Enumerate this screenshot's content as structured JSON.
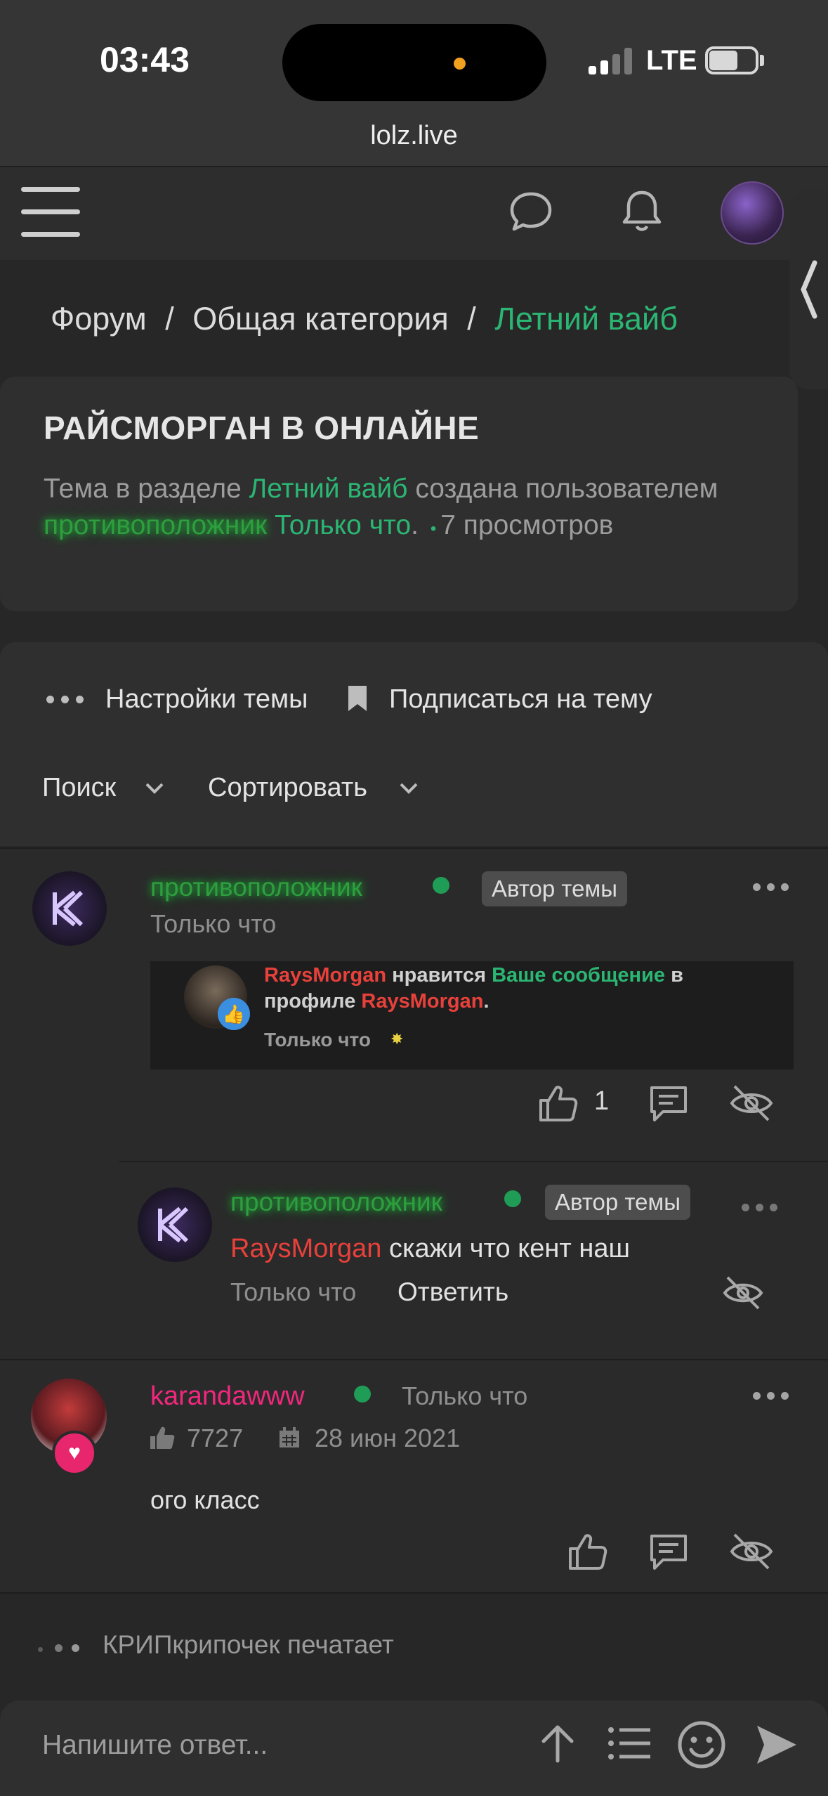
{
  "status_bar": {
    "time": "03:43",
    "network": "LTE"
  },
  "browser": {
    "url": "lolz.live"
  },
  "breadcrumb": {
    "forum": "Форум",
    "sep1": "/",
    "category": "Общая категория",
    "sep2": "/",
    "section": "Летний вайб"
  },
  "thread": {
    "title": "РАЙСМОРГАН В ОНЛАЙНЕ",
    "meta_prefix": "Тема в разделе",
    "meta_section": "Летний вайб",
    "meta_created": "создана пользователем",
    "meta_author": "противоположник",
    "meta_time": "Только что",
    "meta_dot": ".",
    "meta_bullet": "•",
    "meta_views": "7 просмотров"
  },
  "controls": {
    "settings": "Настройки темы",
    "subscribe": "Подписаться на тему",
    "search": "Поиск",
    "sort": "Сортировать"
  },
  "post1": {
    "username": "противоположник",
    "badge": "Автор темы",
    "time": "Только что",
    "notification": {
      "user": "RaysMorgan",
      "likes": "нравится",
      "your_message": "Ваше сообщение",
      "in": "в профиле",
      "profile": "RaysMorgan",
      "dot": ".",
      "time": "Только что"
    },
    "like_count": "1"
  },
  "reply": {
    "username": "противоположник",
    "badge": "Автор темы",
    "mention": "RaysMorgan",
    "text": "скажи что кент наш",
    "time": "Только что",
    "reply_label": "Ответить"
  },
  "post2": {
    "username": "karandawww",
    "time": "Только что",
    "likes": "7727",
    "joined": "28 июн 2021",
    "text": "ого класс"
  },
  "typing": {
    "text": "КРИПкрипочек печатает"
  },
  "reply_box": {
    "placeholder": "Напишите ответ..."
  },
  "colors": {
    "accent_green": "#2bb673",
    "username_glow": "#2e9e3e",
    "mention_red": "#e8413b",
    "user_pink": "#f0287d"
  }
}
